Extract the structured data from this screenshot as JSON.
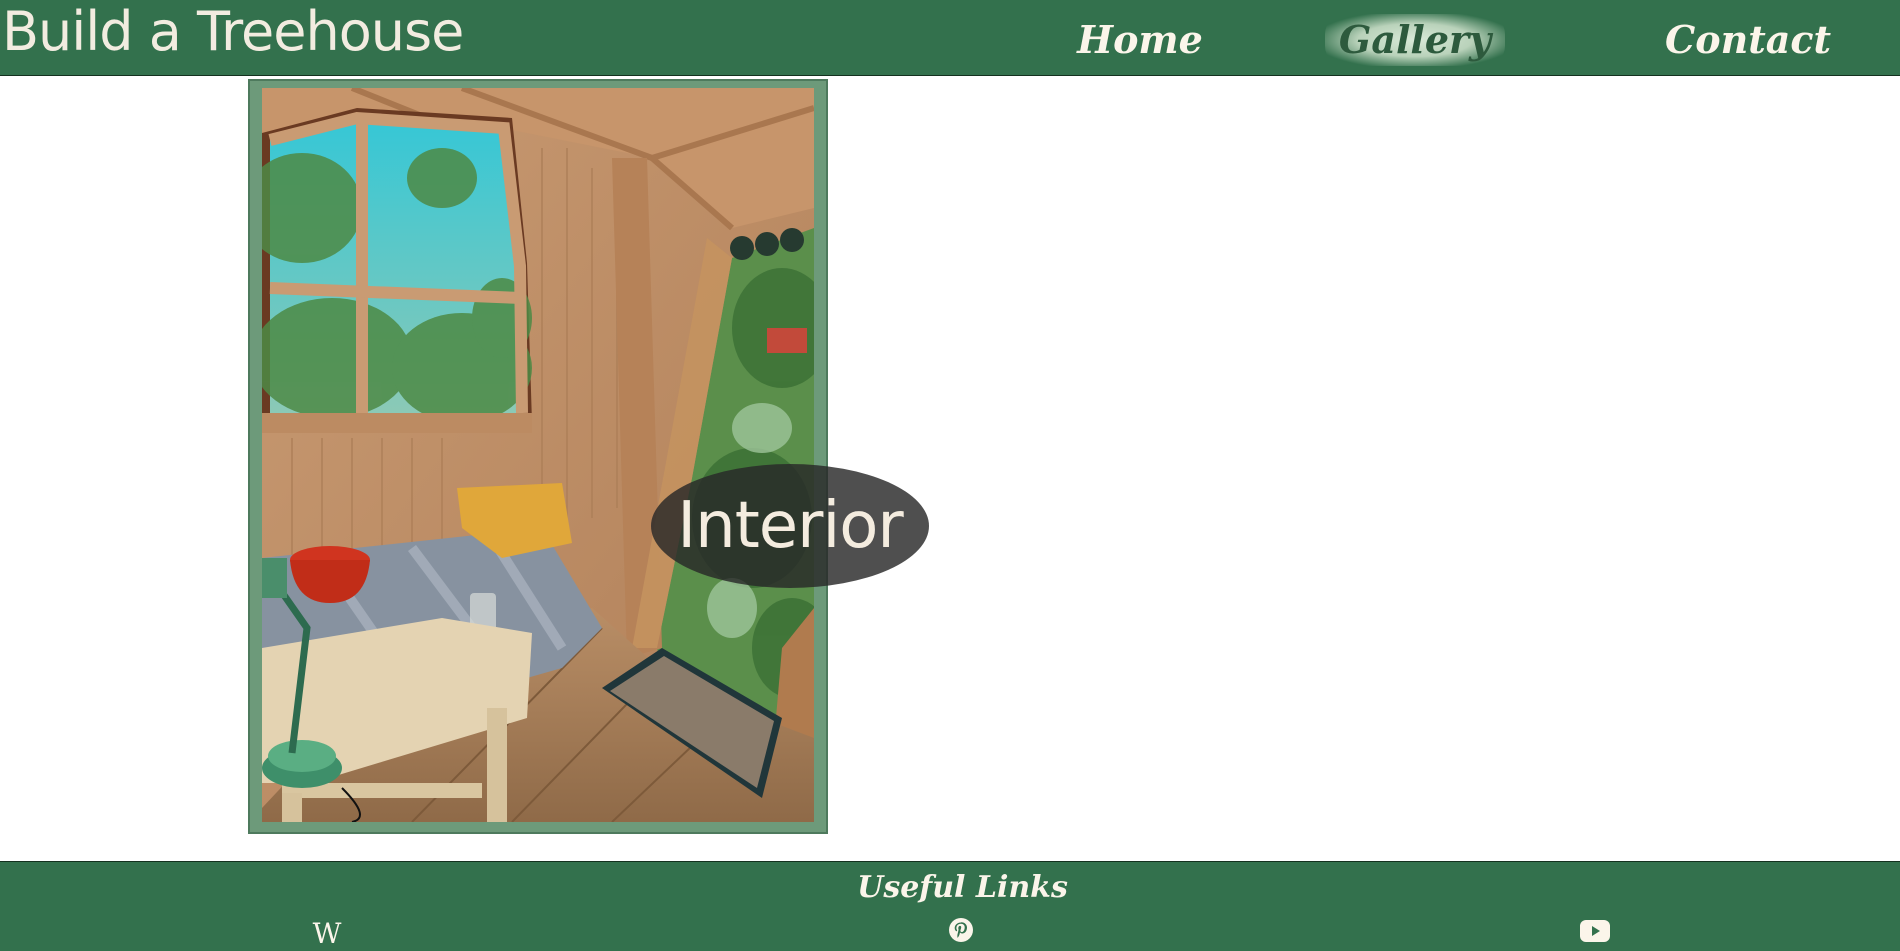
{
  "site": {
    "title": "Build a Treehouse"
  },
  "nav": {
    "items": [
      {
        "label": "Home"
      },
      {
        "label": "Gallery"
      },
      {
        "label": "Contact"
      }
    ],
    "active": "Gallery"
  },
  "gallery": {
    "caption": "Interior"
  },
  "footer": {
    "heading": "Useful Links",
    "links": [
      {
        "icon": "wikipedia-icon",
        "glyph": "W"
      },
      {
        "icon": "pinterest-icon"
      },
      {
        "icon": "youtube-icon"
      }
    ]
  },
  "colors": {
    "header_bg": "#33714d",
    "accent_text": "#fbf5ea",
    "card_frame": "#6d9a7a"
  }
}
